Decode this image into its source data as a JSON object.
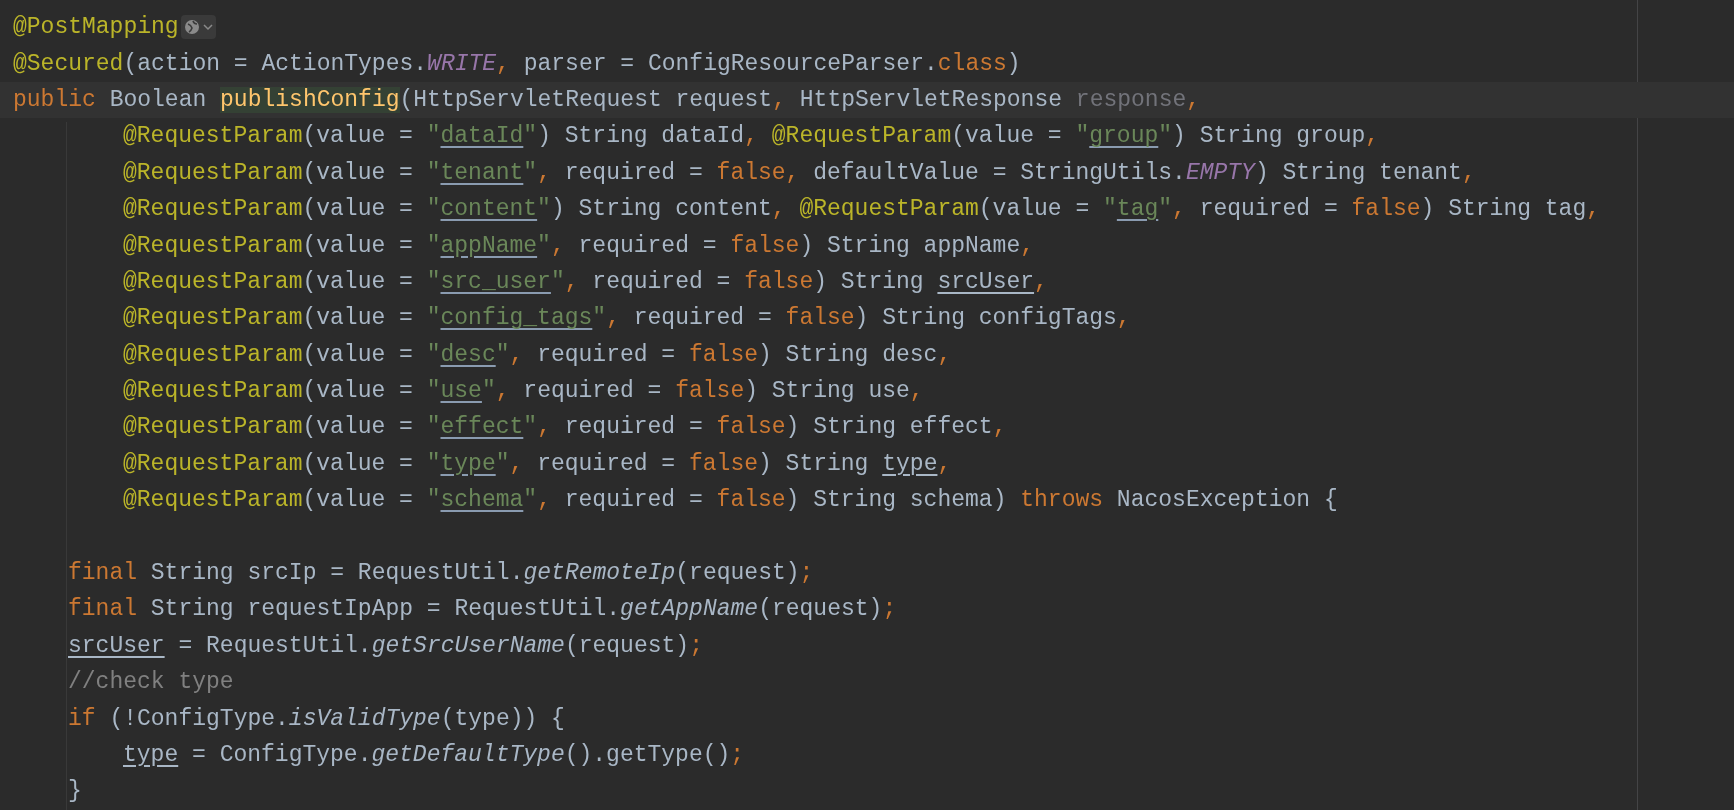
{
  "editor": {
    "lines": [
      {
        "kind": "top",
        "current": false,
        "inlay_icon": true,
        "tokens": [
          {
            "kind": "ann",
            "text": "@PostMapping"
          }
        ]
      },
      {
        "kind": "top",
        "current": false,
        "inlay_icon": false,
        "tokens": [
          {
            "kind": "ann",
            "text": "@Secured"
          },
          {
            "kind": "plain",
            "text": "(action = ActionTypes."
          },
          {
            "kind": "static",
            "text": "WRITE"
          },
          {
            "kind": "punct",
            "text": ","
          },
          {
            "kind": "plain",
            "text": " parser = ConfigResourceParser."
          },
          {
            "kind": "kw",
            "text": "class"
          },
          {
            "kind": "plain",
            "text": ")"
          }
        ]
      },
      {
        "kind": "top",
        "current": true,
        "inlay_icon": false,
        "tokens": [
          {
            "kind": "kw",
            "text": "public"
          },
          {
            "kind": "plain",
            "text": " Boolean "
          },
          {
            "kind": "decl",
            "text": "publishConfig"
          },
          {
            "kind": "plain",
            "text": "(HttpServletRequest request"
          },
          {
            "kind": "punct",
            "text": ","
          },
          {
            "kind": "plain",
            "text": " HttpServletResponse "
          },
          {
            "kind": "unused",
            "text": "response"
          },
          {
            "kind": "punct",
            "text": ","
          }
        ]
      },
      {
        "kind": "cont",
        "current": false,
        "inlay_icon": false,
        "tokens": [
          {
            "kind": "ann",
            "text": "@RequestParam"
          },
          {
            "kind": "plain",
            "text": "(value = "
          },
          {
            "kind": "str",
            "text": "\""
          },
          {
            "kind": "link",
            "text": "dataId"
          },
          {
            "kind": "str",
            "text": "\""
          },
          {
            "kind": "plain",
            "text": ") String dataId"
          },
          {
            "kind": "punct",
            "text": ", "
          },
          {
            "kind": "ann",
            "text": "@RequestParam"
          },
          {
            "kind": "plain",
            "text": "(value = "
          },
          {
            "kind": "str",
            "text": "\""
          },
          {
            "kind": "link",
            "text": "group"
          },
          {
            "kind": "str",
            "text": "\""
          },
          {
            "kind": "plain",
            "text": ") String group"
          },
          {
            "kind": "punct",
            "text": ","
          }
        ]
      },
      {
        "kind": "cont",
        "current": false,
        "inlay_icon": false,
        "tokens": [
          {
            "kind": "ann",
            "text": "@RequestParam"
          },
          {
            "kind": "plain",
            "text": "(value = "
          },
          {
            "kind": "str",
            "text": "\""
          },
          {
            "kind": "link",
            "text": "tenant"
          },
          {
            "kind": "str",
            "text": "\""
          },
          {
            "kind": "punct",
            "text": ","
          },
          {
            "kind": "plain",
            "text": " required = "
          },
          {
            "kind": "kw",
            "text": "false"
          },
          {
            "kind": "punct",
            "text": ","
          },
          {
            "kind": "plain",
            "text": " defaultValue = StringUtils."
          },
          {
            "kind": "static",
            "text": "EMPTY"
          },
          {
            "kind": "plain",
            "text": ") String tenant"
          },
          {
            "kind": "punct",
            "text": ","
          }
        ]
      },
      {
        "kind": "cont",
        "current": false,
        "inlay_icon": false,
        "tokens": [
          {
            "kind": "ann",
            "text": "@RequestParam"
          },
          {
            "kind": "plain",
            "text": "(value = "
          },
          {
            "kind": "str",
            "text": "\""
          },
          {
            "kind": "link",
            "text": "content"
          },
          {
            "kind": "str",
            "text": "\""
          },
          {
            "kind": "plain",
            "text": ") String content"
          },
          {
            "kind": "punct",
            "text": ", "
          },
          {
            "kind": "ann",
            "text": "@RequestParam"
          },
          {
            "kind": "plain",
            "text": "(value = "
          },
          {
            "kind": "str",
            "text": "\""
          },
          {
            "kind": "link",
            "text": "tag"
          },
          {
            "kind": "str",
            "text": "\""
          },
          {
            "kind": "punct",
            "text": ","
          },
          {
            "kind": "plain",
            "text": " required = "
          },
          {
            "kind": "kw",
            "text": "false"
          },
          {
            "kind": "plain",
            "text": ") String tag"
          },
          {
            "kind": "punct",
            "text": ","
          }
        ]
      },
      {
        "kind": "cont",
        "current": false,
        "inlay_icon": false,
        "tokens": [
          {
            "kind": "ann",
            "text": "@RequestParam"
          },
          {
            "kind": "plain",
            "text": "(value = "
          },
          {
            "kind": "str",
            "text": "\""
          },
          {
            "kind": "link",
            "text": "appName"
          },
          {
            "kind": "str",
            "text": "\""
          },
          {
            "kind": "punct",
            "text": ","
          },
          {
            "kind": "plain",
            "text": " required = "
          },
          {
            "kind": "kw",
            "text": "false"
          },
          {
            "kind": "plain",
            "text": ") String appName"
          },
          {
            "kind": "punct",
            "text": ","
          }
        ]
      },
      {
        "kind": "cont",
        "current": false,
        "inlay_icon": false,
        "tokens": [
          {
            "kind": "ann",
            "text": "@RequestParam"
          },
          {
            "kind": "plain",
            "text": "(value = "
          },
          {
            "kind": "str",
            "text": "\""
          },
          {
            "kind": "link",
            "text": "src_user"
          },
          {
            "kind": "str",
            "text": "\""
          },
          {
            "kind": "punct",
            "text": ","
          },
          {
            "kind": "plain",
            "text": " required = "
          },
          {
            "kind": "kw",
            "text": "false"
          },
          {
            "kind": "plain",
            "text": ") String "
          },
          {
            "kind": "var",
            "text": "srcUser"
          },
          {
            "kind": "punct",
            "text": ","
          }
        ]
      },
      {
        "kind": "cont",
        "current": false,
        "inlay_icon": false,
        "tokens": [
          {
            "kind": "ann",
            "text": "@RequestParam"
          },
          {
            "kind": "plain",
            "text": "(value = "
          },
          {
            "kind": "str",
            "text": "\""
          },
          {
            "kind": "link",
            "text": "config_tags"
          },
          {
            "kind": "str",
            "text": "\""
          },
          {
            "kind": "punct",
            "text": ","
          },
          {
            "kind": "plain",
            "text": " required = "
          },
          {
            "kind": "kw",
            "text": "false"
          },
          {
            "kind": "plain",
            "text": ") String configTags"
          },
          {
            "kind": "punct",
            "text": ","
          }
        ]
      },
      {
        "kind": "cont",
        "current": false,
        "inlay_icon": false,
        "tokens": [
          {
            "kind": "ann",
            "text": "@RequestParam"
          },
          {
            "kind": "plain",
            "text": "(value = "
          },
          {
            "kind": "str",
            "text": "\""
          },
          {
            "kind": "link",
            "text": "desc"
          },
          {
            "kind": "str",
            "text": "\""
          },
          {
            "kind": "punct",
            "text": ","
          },
          {
            "kind": "plain",
            "text": " required = "
          },
          {
            "kind": "kw",
            "text": "false"
          },
          {
            "kind": "plain",
            "text": ") String desc"
          },
          {
            "kind": "punct",
            "text": ","
          }
        ]
      },
      {
        "kind": "cont",
        "current": false,
        "inlay_icon": false,
        "tokens": [
          {
            "kind": "ann",
            "text": "@RequestParam"
          },
          {
            "kind": "plain",
            "text": "(value = "
          },
          {
            "kind": "str",
            "text": "\""
          },
          {
            "kind": "link",
            "text": "use"
          },
          {
            "kind": "str",
            "text": "\""
          },
          {
            "kind": "punct",
            "text": ","
          },
          {
            "kind": "plain",
            "text": " required = "
          },
          {
            "kind": "kw",
            "text": "false"
          },
          {
            "kind": "plain",
            "text": ") String use"
          },
          {
            "kind": "punct",
            "text": ","
          }
        ]
      },
      {
        "kind": "cont",
        "current": false,
        "inlay_icon": false,
        "tokens": [
          {
            "kind": "ann",
            "text": "@RequestParam"
          },
          {
            "kind": "plain",
            "text": "(value = "
          },
          {
            "kind": "str",
            "text": "\""
          },
          {
            "kind": "link",
            "text": "effect"
          },
          {
            "kind": "str",
            "text": "\""
          },
          {
            "kind": "punct",
            "text": ","
          },
          {
            "kind": "plain",
            "text": " required = "
          },
          {
            "kind": "kw",
            "text": "false"
          },
          {
            "kind": "plain",
            "text": ") String effect"
          },
          {
            "kind": "punct",
            "text": ","
          }
        ]
      },
      {
        "kind": "cont",
        "current": false,
        "inlay_icon": false,
        "tokens": [
          {
            "kind": "ann",
            "text": "@RequestParam"
          },
          {
            "kind": "plain",
            "text": "(value = "
          },
          {
            "kind": "str",
            "text": "\""
          },
          {
            "kind": "link",
            "text": "type"
          },
          {
            "kind": "str",
            "text": "\""
          },
          {
            "kind": "punct",
            "text": ","
          },
          {
            "kind": "plain",
            "text": " required = "
          },
          {
            "kind": "kw",
            "text": "false"
          },
          {
            "kind": "plain",
            "text": ") String "
          },
          {
            "kind": "var",
            "text": "type"
          },
          {
            "kind": "punct",
            "text": ","
          }
        ]
      },
      {
        "kind": "cont",
        "current": false,
        "inlay_icon": false,
        "tokens": [
          {
            "kind": "ann",
            "text": "@RequestParam"
          },
          {
            "kind": "plain",
            "text": "(value = "
          },
          {
            "kind": "str",
            "text": "\""
          },
          {
            "kind": "link",
            "text": "schema"
          },
          {
            "kind": "str",
            "text": "\""
          },
          {
            "kind": "punct",
            "text": ","
          },
          {
            "kind": "plain",
            "text": " required = "
          },
          {
            "kind": "kw",
            "text": "false"
          },
          {
            "kind": "plain",
            "text": ") String schema) "
          },
          {
            "kind": "kw",
            "text": "throws"
          },
          {
            "kind": "plain",
            "text": " NacosException {"
          }
        ]
      },
      {
        "kind": "blank",
        "current": false,
        "inlay_icon": false
      },
      {
        "kind": "body",
        "current": false,
        "inlay_icon": false,
        "tokens": [
          {
            "kind": "kw",
            "text": "final"
          },
          {
            "kind": "plain",
            "text": " String srcIp = RequestUtil."
          },
          {
            "kind": "call",
            "text": "getRemoteIp"
          },
          {
            "kind": "plain",
            "text": "(request)"
          },
          {
            "kind": "punct",
            "text": ";"
          }
        ]
      },
      {
        "kind": "body",
        "current": false,
        "inlay_icon": false,
        "tokens": [
          {
            "kind": "kw",
            "text": "final"
          },
          {
            "kind": "plain",
            "text": " String requestIpApp = RequestUtil."
          },
          {
            "kind": "call",
            "text": "getAppName"
          },
          {
            "kind": "plain",
            "text": "(request)"
          },
          {
            "kind": "punct",
            "text": ";"
          }
        ]
      },
      {
        "kind": "body",
        "current": false,
        "inlay_icon": false,
        "tokens": [
          {
            "kind": "var",
            "text": "srcUser"
          },
          {
            "kind": "plain",
            "text": " = RequestUtil."
          },
          {
            "kind": "call",
            "text": "getSrcUserName"
          },
          {
            "kind": "plain",
            "text": "(request)"
          },
          {
            "kind": "punct",
            "text": ";"
          }
        ]
      },
      {
        "kind": "body",
        "current": false,
        "inlay_icon": false,
        "tokens": [
          {
            "kind": "comment",
            "text": "//check type"
          }
        ]
      },
      {
        "kind": "body",
        "current": false,
        "inlay_icon": false,
        "tokens": [
          {
            "kind": "kw",
            "text": "if"
          },
          {
            "kind": "plain",
            "text": " (!ConfigType."
          },
          {
            "kind": "call",
            "text": "isValidType"
          },
          {
            "kind": "plain",
            "text": "(type)) {"
          }
        ]
      },
      {
        "kind": "nested",
        "current": false,
        "inlay_icon": false,
        "tokens": [
          {
            "kind": "var",
            "text": "type"
          },
          {
            "kind": "plain",
            "text": " = ConfigType."
          },
          {
            "kind": "call",
            "text": "getDefaultType"
          },
          {
            "kind": "plain",
            "text": "().getType()"
          },
          {
            "kind": "punct",
            "text": ";"
          }
        ]
      },
      {
        "kind": "body",
        "current": false,
        "inlay_icon": false,
        "tokens": [
          {
            "kind": "plain",
            "text": "}"
          }
        ]
      }
    ]
  }
}
